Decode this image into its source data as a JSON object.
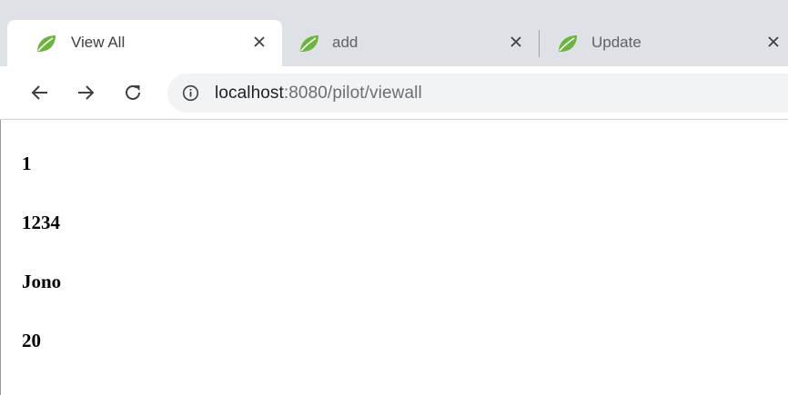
{
  "tabs": [
    {
      "title": "View All",
      "active": true
    },
    {
      "title": "add",
      "active": false
    },
    {
      "title": "Update",
      "active": false
    }
  ],
  "address_bar": {
    "host": "localhost",
    "rest": ":8080/pilot/viewall"
  },
  "page": {
    "values": [
      "1",
      "1234",
      "Jono",
      "20"
    ]
  },
  "colors": {
    "tabstrip_bg": "#dee1e6",
    "omnibox_bg": "#f1f3f4",
    "favicon_leaf": "#6db33f"
  },
  "icons": {
    "favicon": "spring-leaf-icon",
    "close": "close-icon",
    "back": "arrow-left-icon",
    "forward": "arrow-right-icon",
    "reload": "reload-icon",
    "info": "info-icon"
  }
}
